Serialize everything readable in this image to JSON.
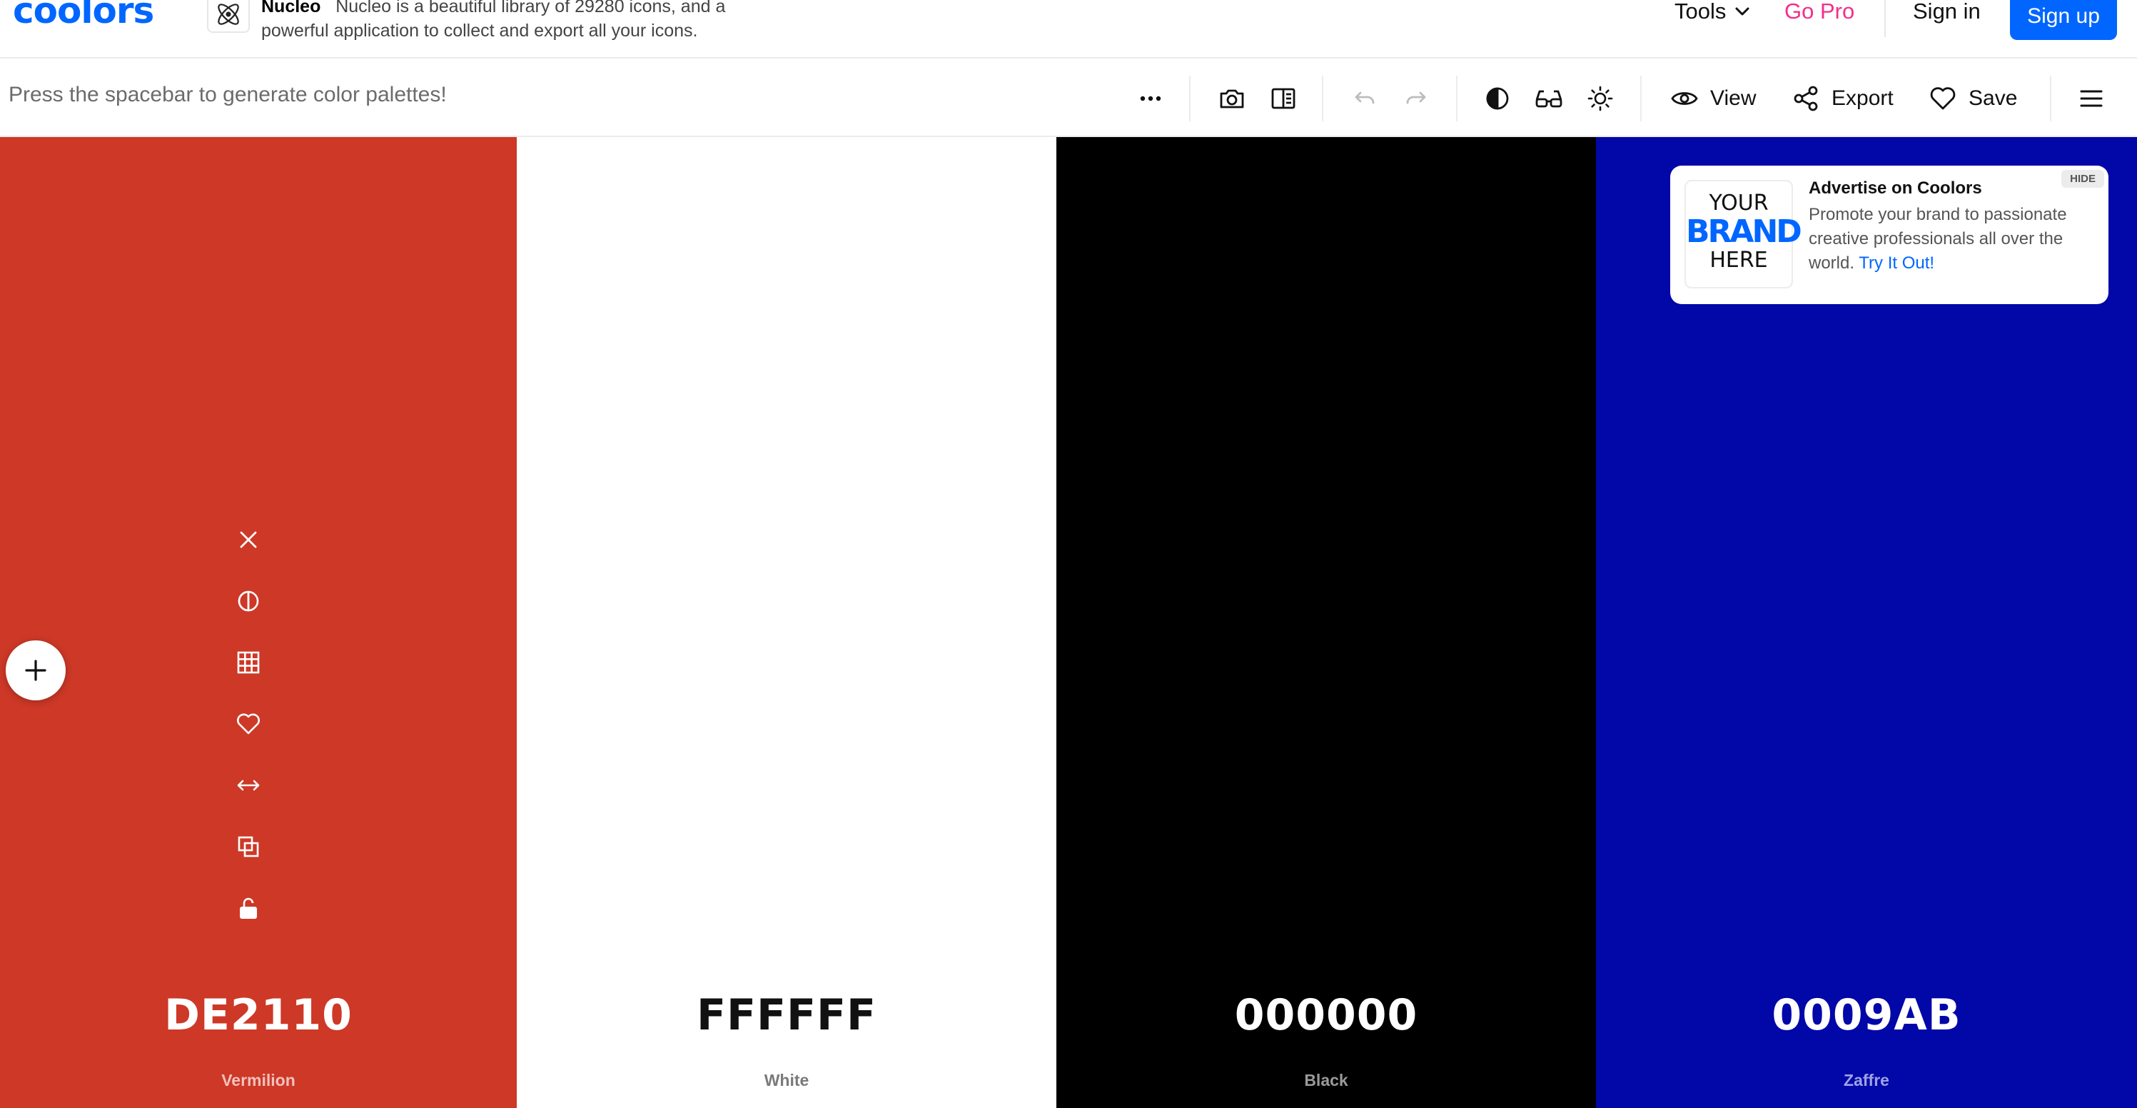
{
  "nav": {
    "logo": "coolors",
    "ad_title": "Nucleo",
    "ad_text_line1": "Nucleo is a beautiful library of 29280 icons, and a",
    "ad_text_line2": "powerful application to collect and export all your icons.",
    "tools_label": "Tools",
    "gopro_label": "Go Pro",
    "signin_label": "Sign in",
    "signup_label": "Sign up"
  },
  "toolbar": {
    "hint": "Press the spacebar to generate color palettes!",
    "view_label": "View",
    "export_label": "Export",
    "save_label": "Save"
  },
  "palette": [
    {
      "hex": "DE2110",
      "name": "Vermilion",
      "color": "#cd3827",
      "text_color": "#ffffff",
      "name_color": "#f2c2bc"
    },
    {
      "hex": "FFFFFF",
      "name": "White",
      "color": "#ffffff",
      "text_color": "#111111",
      "name_color": "#7a7a7a"
    },
    {
      "hex": "000000",
      "name": "Black",
      "color": "#000000",
      "text_color": "#ffffff",
      "name_color": "#9a9a9a"
    },
    {
      "hex": "0009AB",
      "name": "Zaffre",
      "color": "#0207a8",
      "text_color": "#ffffff",
      "name_color": "#9ea2e6"
    }
  ],
  "ad_card": {
    "logo_line1": "YOUR",
    "logo_line2": "BRAND",
    "logo_line3": "HERE",
    "title": "Advertise on Coolors",
    "body": "Promote your brand to passionate creative professionals all over the world.",
    "link": "Try It Out!",
    "hide_label": "HIDE"
  },
  "colors": {
    "brand": "#0066ff",
    "gopro": "#f52e8a"
  }
}
